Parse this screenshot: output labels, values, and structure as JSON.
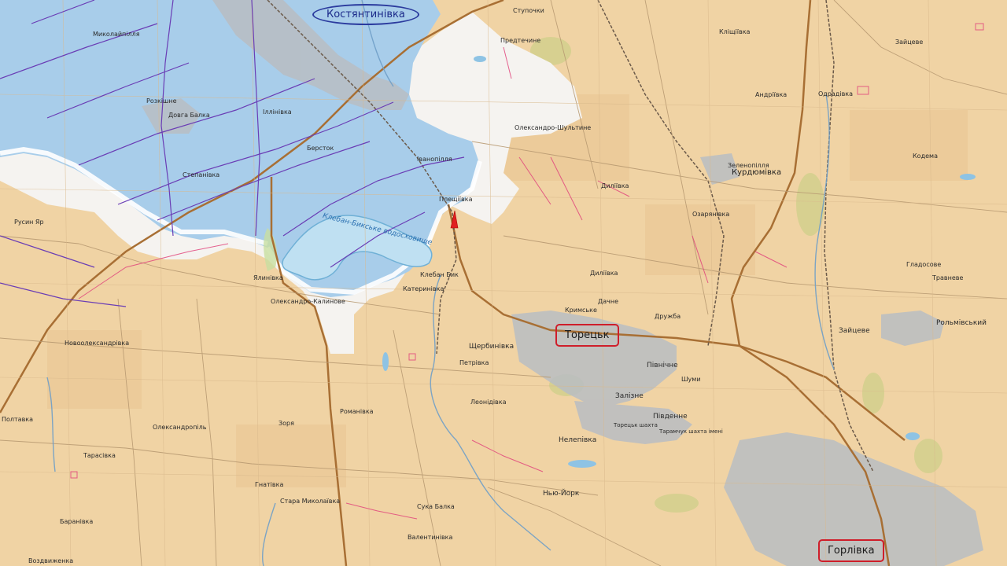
{
  "map": {
    "highlighted": {
      "kostiantynivka": "Костянтинівка",
      "toretsk": "Торецьк",
      "horlivka": "Горлівка"
    },
    "water": {
      "reservoir": "Клебан-Бикське водосховище"
    },
    "places": [
      "Ступочки",
      "Предтечине",
      "Миколайпілля",
      "Розкішне",
      "Довга Балка",
      "Іллінівка",
      "Олександро-Шультине",
      "Берсток",
      "Іванопілля",
      "Степанівка",
      "Плещіївка",
      "Русин Яр",
      "Ялинівка",
      "Олександро-Калинове",
      "Катеринівка",
      "Клебан Бик",
      "Новоолександрівка",
      "Щербинівка",
      "Петрівка",
      "Полтавка",
      "Олександропіль",
      "Романівка",
      "Зоря",
      "Леонідівка",
      "Тарасівка",
      "Гнатівка",
      "Стара Миколаївка",
      "Нелепівка",
      "Нью-Йорк",
      "Сука Балка",
      "Баранівка",
      "Валентинівка",
      "Кримське",
      "Дачне",
      "Дружба",
      "Північне",
      "Залізне",
      "Південне",
      "Шуми",
      "Дилiївка",
      "Диліївка",
      "Озарянівка",
      "Курдюмівка",
      "Зеленопілля",
      "Клiщіївка",
      "Андріївка",
      "Одрадівка",
      "Зайцеве",
      "Кодема",
      "Гладосове",
      "Травневе",
      "Рольмівський",
      "Зайцеве",
      "Торецьк шахта",
      "Тарамчук шахта імені",
      "Воздвиженка"
    ]
  }
}
